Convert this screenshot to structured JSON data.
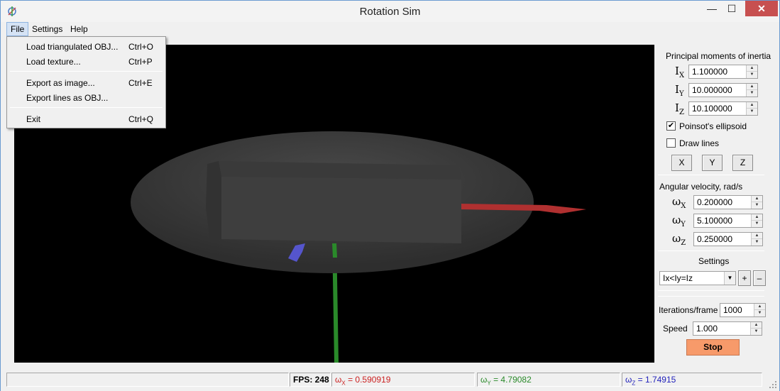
{
  "window": {
    "title": "Rotation Sim",
    "minimize_glyph": "—",
    "maximize_glyph": "☐",
    "close_glyph": "✕"
  },
  "menubar": {
    "file": "File",
    "settings": "Settings",
    "help": "Help"
  },
  "file_menu": {
    "load_obj": {
      "label": "Load triangulated OBJ...",
      "shortcut": "Ctrl+O"
    },
    "load_texture": {
      "label": "Load texture...",
      "shortcut": "Ctrl+P"
    },
    "export_image": {
      "label": "Export as image...",
      "shortcut": "Ctrl+E"
    },
    "export_lines": {
      "label": "Export lines as OBJ..."
    },
    "exit": {
      "label": "Exit",
      "shortcut": "Ctrl+Q"
    }
  },
  "panel": {
    "inertia_title": "Principal moments of inertia",
    "inertia": [
      {
        "sym": "I",
        "sub": "X",
        "value": "1.100000"
      },
      {
        "sym": "I",
        "sub": "Y",
        "value": "10.000000"
      },
      {
        "sym": "I",
        "sub": "Z",
        "value": "10.100000"
      }
    ],
    "poinsot": {
      "label": "Poinsot's ellipsoid",
      "checked": true,
      "mark": "✔"
    },
    "draw_lines": {
      "label": "Draw lines",
      "checked": false
    },
    "axis_buttons": [
      "X",
      "Y",
      "Z"
    ],
    "angular_title": "Angular velocity, rad/s",
    "omega": [
      {
        "sym": "ω",
        "sub": "X",
        "value": "0.200000"
      },
      {
        "sym": "ω",
        "sub": "Y",
        "value": "5.100000"
      },
      {
        "sym": "ω",
        "sub": "Z",
        "value": "0.250000"
      }
    ],
    "settings_title": "Settings",
    "preset": "Ix<Iy=Iz",
    "plus": "+",
    "minus": "–",
    "iterations_label": "Iterations/frame",
    "iterations_value": "1000",
    "speed_label": "Speed",
    "speed_value": "1.000",
    "stop_label": "Stop"
  },
  "status": {
    "fps": "FPS: 248",
    "wx_sym": "ω",
    "wx_sub": "X",
    "wx_value": "= 0.590919",
    "wy_sym": "ω",
    "wy_sub": "Y",
    "wy_value": "= 4.79082",
    "wz_sym": "ω",
    "wz_sub": "Z",
    "wz_value": "= 1.74915"
  },
  "colors": {
    "x_axis": "#cc2222",
    "y_axis": "#2a8a2a",
    "z_axis": "#2222bb",
    "stop_button": "#f79a6a"
  },
  "icons": {
    "spin_up": "▲",
    "spin_down": "▼",
    "combo_arrow": "▼"
  }
}
